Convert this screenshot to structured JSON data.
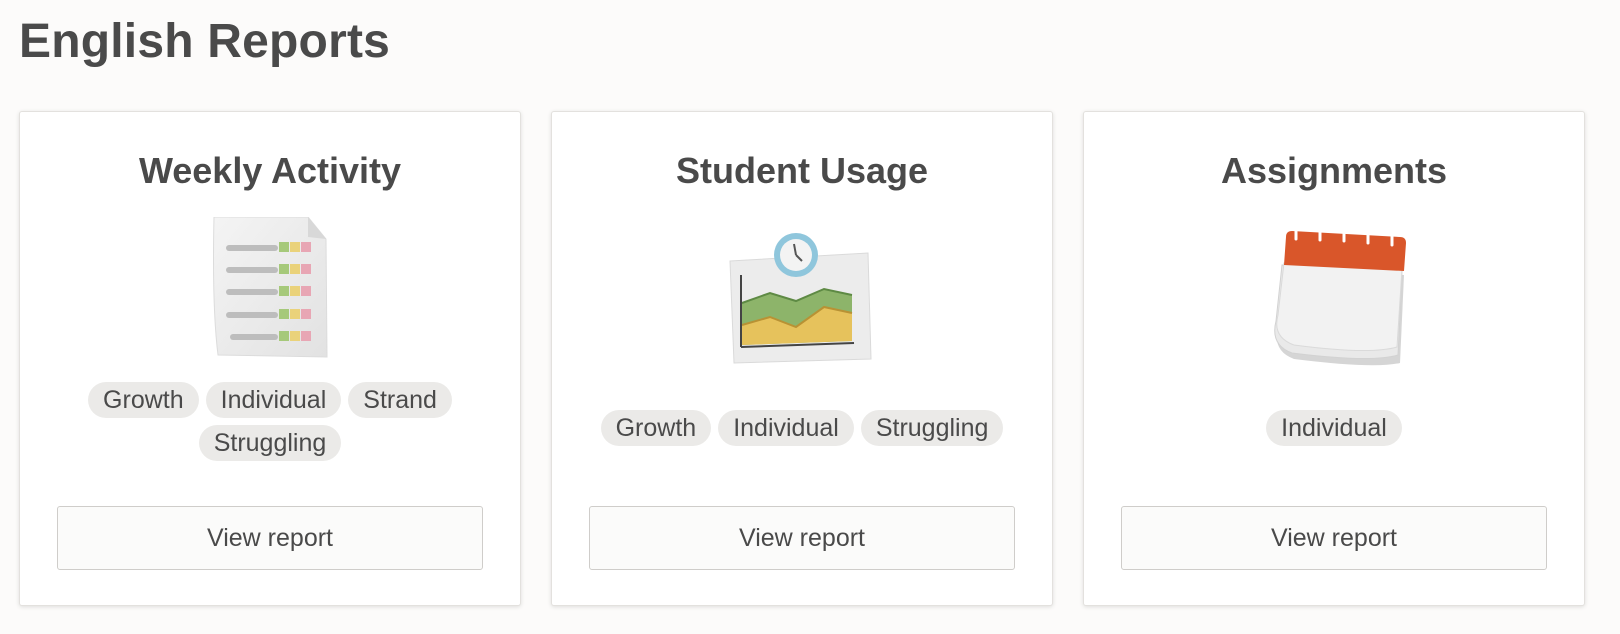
{
  "page": {
    "title": "English Reports"
  },
  "cards": [
    {
      "title": "Weekly Activity",
      "icon": "report-sheet-icon",
      "tags": [
        "Growth",
        "Individual",
        "Strand",
        "Struggling"
      ],
      "button_label": "View report"
    },
    {
      "title": "Student Usage",
      "icon": "usage-chart-clock-icon",
      "tags": [
        "Growth",
        "Individual",
        "Struggling"
      ],
      "button_label": "View report"
    },
    {
      "title": "Assignments",
      "icon": "calendar-icon",
      "tags": [
        "Individual"
      ],
      "button_label": "View report"
    }
  ],
  "colors": {
    "text": "#4a4a4a",
    "tag_background": "#ebeae8",
    "page_background": "#fcfbfa",
    "calendar_accent": "#d9562a",
    "chart_green": "#8db46a",
    "chart_yellow": "#e6c25c"
  }
}
